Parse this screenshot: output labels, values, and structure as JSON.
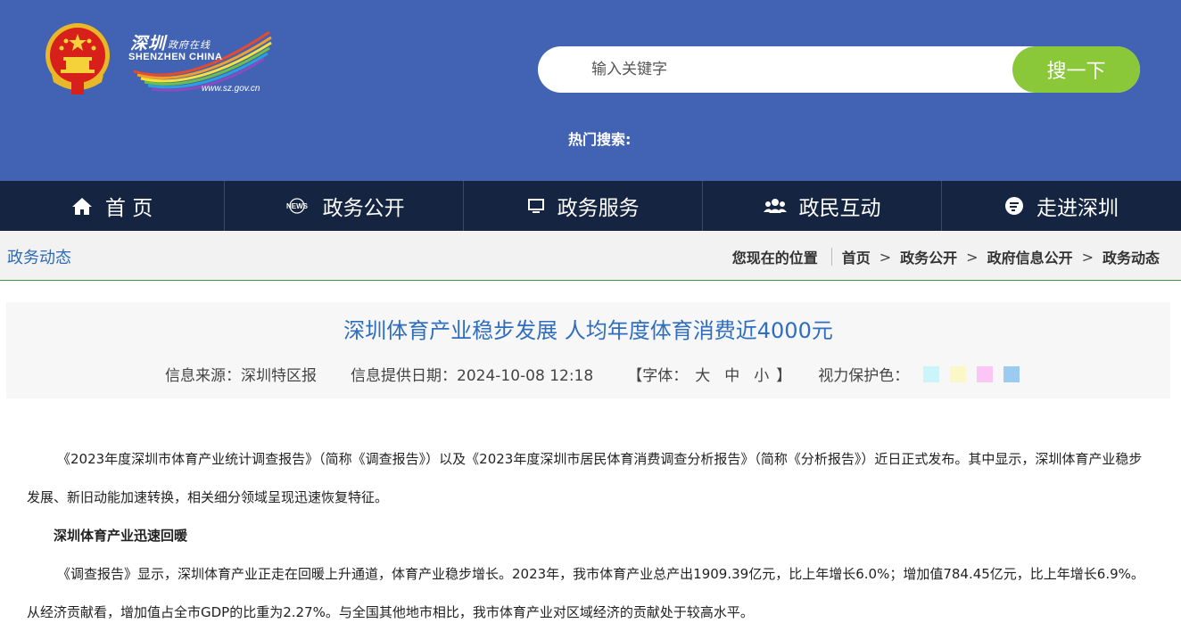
{
  "header": {
    "logo": {
      "cn_name": "深圳",
      "cn_sub": "政府在线",
      "en_name": "SHENZHEN CHINA",
      "url": "www.sz.gov.cn"
    },
    "search": {
      "placeholder": "输入关键字",
      "button_label": "搜一下"
    },
    "hot_search_label": "热门搜索:"
  },
  "nav": {
    "items": [
      {
        "label": "首 页",
        "icon": "home-icon"
      },
      {
        "label": "政务公开",
        "icon": "news-icon"
      },
      {
        "label": "政务服务",
        "icon": "monitor-icon"
      },
      {
        "label": "政民互动",
        "icon": "people-icon"
      },
      {
        "label": "走进深圳",
        "icon": "chat-icon"
      }
    ]
  },
  "breadcrumb": {
    "section_title": "政务动态",
    "location_label": "您现在的位置",
    "items": [
      "首页",
      "政务公开",
      "政府信息公开",
      "政务动态"
    ],
    "separator": ">"
  },
  "article": {
    "title": "深圳体育产业稳步发展 人均年度体育消费近4000元",
    "source": "信息来源：深圳特区报",
    "date": "信息提供日期：2024-10-08 12:18",
    "font_label_open": "【字体：",
    "font_sizes": [
      "大",
      "中",
      "小"
    ],
    "font_label_close": "】",
    "eye_care_label": "视力保护色：",
    "eye_care_colors": [
      "#ccf5fb",
      "#fbf7c6",
      "#fbc6f5",
      "#9ccbf2"
    ],
    "paragraphs": [
      "《2023年度深圳市体育产业统计调查报告》（简称《调查报告》）以及《2023年度深圳市居民体育消费调查分析报告》（简称《分析报告》）近日正式发布。其中显示，深圳体育产业稳步发展、新旧动能加速转换，相关细分领域呈现迅速恢复特征。",
      "深圳体育产业迅速回暖",
      "《调查报告》显示，深圳体育产业正走在回暖上升通道，体育产业稳步增长。2023年，我市体育产业总产出1909.39亿元，比上年增长6.0%；增加值784.45亿元，比上年增长6.9%。从经济贡献看，增加值占全市GDP的比重为2.27%。与全国其他地市相比，我市体育产业对区域经济的贡献处于较高水平。"
    ]
  },
  "colors": {
    "header_bg": "#4263b3",
    "nav_bg": "#152440",
    "search_button": "#8ac83a",
    "title_blue": "#2f6dc0",
    "link_blue": "#2c6bb8"
  }
}
